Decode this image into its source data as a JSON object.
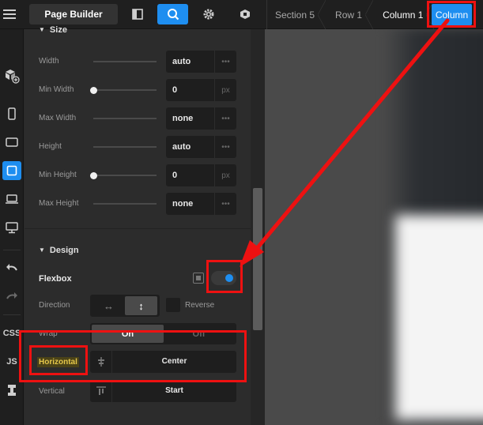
{
  "topbar": {
    "menu_icon": "hamburger-icon",
    "page_builder_label": "Page Builder",
    "icons": [
      "sidebar-toggle-icon",
      "search-icon",
      "gear-icon",
      "shield-icon"
    ],
    "breadcrumbs": [
      "Section 5",
      "Row 1",
      "Column 1"
    ],
    "active_element": "Column"
  },
  "left_toolbar": {
    "icons": [
      "add-element-icon",
      "mobile-icon",
      "tablet-landscape-icon",
      "tablet-icon",
      "laptop-icon",
      "desktop-icon",
      "undo-icon",
      "redo-icon",
      "template-icon"
    ],
    "css_label": "CSS",
    "js_label": "JS"
  },
  "size": {
    "title": "Size",
    "rows": [
      {
        "label": "Width",
        "value": "auto",
        "unit": "•••"
      },
      {
        "label": "Min Width",
        "value": "0",
        "unit": "px"
      },
      {
        "label": "Max Width",
        "value": "none",
        "unit": "•••"
      },
      {
        "label": "Height",
        "value": "auto",
        "unit": "•••"
      },
      {
        "label": "Min Height",
        "value": "0",
        "unit": "px"
      },
      {
        "label": "Max Height",
        "value": "none",
        "unit": "•••"
      }
    ]
  },
  "design": {
    "title": "Design",
    "flexbox_label": "Flexbox",
    "flexbox_enabled": true,
    "direction_label": "Direction",
    "direction_options": [
      "↔",
      "↕"
    ],
    "direction_selected": "vertical",
    "reverse_label": "Reverse",
    "wrap_label": "Wrap",
    "wrap_on": "On",
    "wrap_off": "Off",
    "horizontal_label": "Horizontal",
    "horizontal_value": "Center",
    "vertical_label": "Vertical",
    "vertical_value": "Start"
  },
  "colors": {
    "accent": "#1e8ef0",
    "annotation": "#ee1111"
  }
}
